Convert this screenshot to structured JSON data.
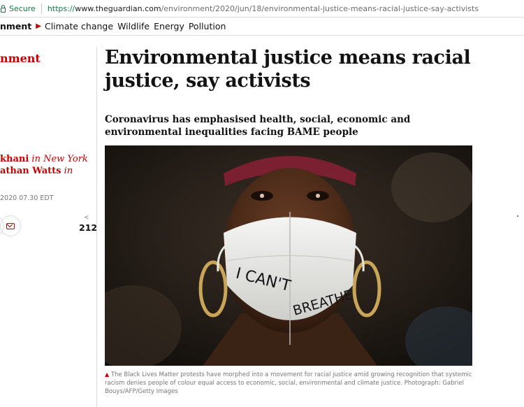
{
  "browser": {
    "security_label": "Secure",
    "url_protocol": "https://",
    "url_host": "www.theguardian.com",
    "url_path": "/environment/2020/jun/18/environmental-justice-means-racial-justice-say-activists"
  },
  "nav": {
    "section": "nment",
    "links": [
      "Climate change",
      "Wildlife",
      "Energy",
      "Pollution"
    ]
  },
  "sidebar": {
    "section_label": "nment",
    "byline_line1_name": "khani",
    "byline_line1_place": "in New York",
    "byline_line2_name": "athan Watts",
    "byline_line2_place": "in",
    "dateline": "2020 07.30 EDT",
    "share_count": "212"
  },
  "article": {
    "headline": "Environmental justice means racial justice, say activists",
    "standfirst": "Coronavirus has emphasised health, social, economic and environmental inequalities facing BAME people",
    "mask_text_1": "I CAN'T",
    "mask_text_2": "BREATHE",
    "caption": "The Black Lives Matter protests have morphed into a movement for racial justice amid growing recognition that systemic racism denies people of colour equal access to economic, social, environmental and climate justice.",
    "photo_credit": "Photograph: Gabriel Bouys/AFP/Getty Images"
  },
  "colors": {
    "accent_red": "#c70000",
    "secure_green": "#0b8043",
    "muted_text": "#767676"
  }
}
